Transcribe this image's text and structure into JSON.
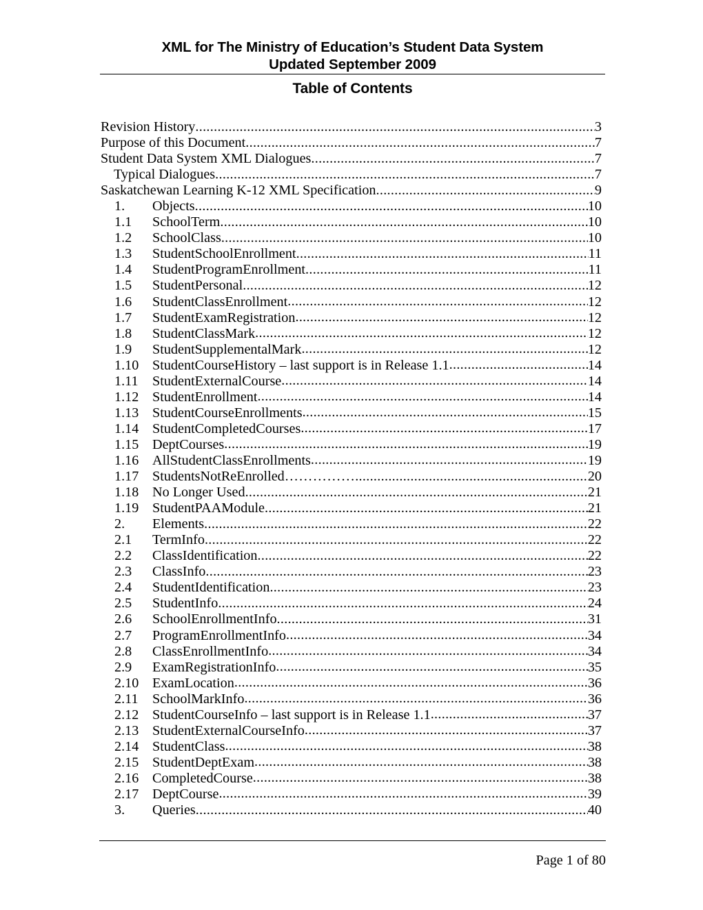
{
  "header": {
    "line1": "XML for The Ministry of Education’s Student Data System",
    "line2": "Updated September 2009",
    "line3": "Table of Contents"
  },
  "toc": {
    "entries": [
      {
        "level": 0,
        "num": "",
        "title": "Revision History",
        "page": "3",
        "leader": "normal"
      },
      {
        "level": 0,
        "num": "",
        "title": "Purpose of this Document",
        "page": "7",
        "leader": "normal"
      },
      {
        "level": 0,
        "num": "",
        "title": "Student Data System XML Dialogues",
        "page": "7",
        "leader": "normal"
      },
      {
        "level": 1,
        "num": "",
        "title": "Typical Dialogues",
        "page": "7",
        "leader": "normal"
      },
      {
        "level": 0,
        "num": "",
        "title": "Saskatchewan Learning K-12 XML Specification",
        "page": "9",
        "leader": "normal"
      },
      {
        "level": 2,
        "num": "1.",
        "title": "Objects",
        "page": "10",
        "leader": "normal"
      },
      {
        "level": 2,
        "num": "1.1",
        "title": "SchoolTerm",
        "page": "10",
        "leader": "normal"
      },
      {
        "level": 2,
        "num": "1.2",
        "title": "SchoolClass",
        "page": "10",
        "leader": "normal"
      },
      {
        "level": 2,
        "num": "1.3",
        "title": "StudentSchoolEnrollment",
        "page": "11",
        "leader": "normal"
      },
      {
        "level": 2,
        "num": "1.4",
        "title": "StudentProgramEnrollment",
        "page": "11",
        "leader": "normal"
      },
      {
        "level": 2,
        "num": "1.5",
        "title": "StudentPersonal",
        "page": "12",
        "leader": "normal"
      },
      {
        "level": 2,
        "num": "1.6",
        "title": "StudentClassEnrollment",
        "page": "12",
        "leader": "normal"
      },
      {
        "level": 2,
        "num": "1.7",
        "title": "StudentExamRegistration",
        "page": "12",
        "leader": "normal"
      },
      {
        "level": 2,
        "num": "1.8",
        "title": "StudentClassMark",
        "page": "12",
        "leader": "normal"
      },
      {
        "level": 2,
        "num": "1.9",
        "title": "StudentSupplementalMark",
        "page": "12",
        "leader": "normal"
      },
      {
        "level": 2,
        "num": "1.10",
        "title": "StudentCourseHistory – last support is in Release 1.1",
        "page": "14",
        "leader": "normal"
      },
      {
        "level": 2,
        "num": "1.11",
        "title": "StudentExternalCourse",
        "page": "14",
        "leader": "normal"
      },
      {
        "level": 2,
        "num": "1.12",
        "title": "StudentEnrollment",
        "page": "14",
        "leader": "normal"
      },
      {
        "level": 2,
        "num": "1.13",
        "title": "StudentCourseEnrollments",
        "page": "15",
        "leader": "normal"
      },
      {
        "level": 2,
        "num": "1.14",
        "title": "StudentCompletedCourses",
        "page": "17",
        "leader": "normal"
      },
      {
        "level": 2,
        "num": "1.15",
        "title": "DeptCourses",
        "page": "19",
        "leader": "normal"
      },
      {
        "level": 2,
        "num": "1.16",
        "title": "AllStudentClassEnrollments",
        "page": "19",
        "leader": "normal"
      },
      {
        "level": 2,
        "num": "1.17",
        "title": "StudentsNotReEnrolled",
        "page": "20",
        "leader": "wide"
      },
      {
        "level": 2,
        "num": "1.18",
        "title": "No Longer Used",
        "page": "21",
        "leader": "normal"
      },
      {
        "level": 2,
        "num": "1.19",
        "title": "StudentPAAModule",
        "page": "21",
        "leader": "normal"
      },
      {
        "level": 2,
        "num": "2.",
        "title": "Elements",
        "page": "22",
        "leader": "normal"
      },
      {
        "level": 2,
        "num": "2.1",
        "title": "TermInfo",
        "page": "22",
        "leader": "normal"
      },
      {
        "level": 2,
        "num": "2.2",
        "title": "ClassIdentification",
        "page": "22",
        "leader": "normal"
      },
      {
        "level": 2,
        "num": "2.3",
        "title": "ClassInfo",
        "page": "23",
        "leader": "normal"
      },
      {
        "level": 2,
        "num": "2.4",
        "title": "StudentIdentification",
        "page": "23",
        "leader": "normal"
      },
      {
        "level": 2,
        "num": "2.5",
        "title": "StudentInfo",
        "page": "24",
        "leader": "normal"
      },
      {
        "level": 2,
        "num": "2.6",
        "title": "SchoolEnrollmentInfo",
        "page": "31",
        "leader": "normal"
      },
      {
        "level": 2,
        "num": "2.7",
        "title": "ProgramEnrollmentInfo",
        "page": "34",
        "leader": "normal"
      },
      {
        "level": 2,
        "num": "2.8",
        "title": "ClassEnrollmentInfo",
        "page": "34",
        "leader": "normal"
      },
      {
        "level": 2,
        "num": "2.9",
        "title": "ExamRegistrationInfo",
        "page": "35",
        "leader": "normal"
      },
      {
        "level": 2,
        "num": "2.10",
        "title": "ExamLocation",
        "page": "36",
        "leader": "normal"
      },
      {
        "level": 2,
        "num": "2.11",
        "title": "SchoolMarkInfo",
        "page": "36",
        "leader": "normal"
      },
      {
        "level": 2,
        "num": "2.12",
        "title": "StudentCourseInfo – last support is in Release 1.1",
        "page": "37",
        "leader": "normal"
      },
      {
        "level": 2,
        "num": "2.13",
        "title": "StudentExternalCourseInfo",
        "page": "37",
        "leader": "normal"
      },
      {
        "level": 2,
        "num": "2.14",
        "title": "StudentClass",
        "page": "38",
        "leader": "normal"
      },
      {
        "level": 2,
        "num": "2.15",
        "title": "StudentDeptExam",
        "page": "38",
        "leader": "normal"
      },
      {
        "level": 2,
        "num": "2.16",
        "title": "CompletedCourse",
        "page": "38",
        "leader": "normal"
      },
      {
        "level": 2,
        "num": "2.17",
        "title": "DeptCourse",
        "page": "39",
        "leader": "normal"
      },
      {
        "level": 2,
        "num": "3.",
        "title": "Queries",
        "page": "40",
        "leader": "normal"
      }
    ]
  },
  "footer": {
    "page_label": "Page 1 of 80"
  }
}
